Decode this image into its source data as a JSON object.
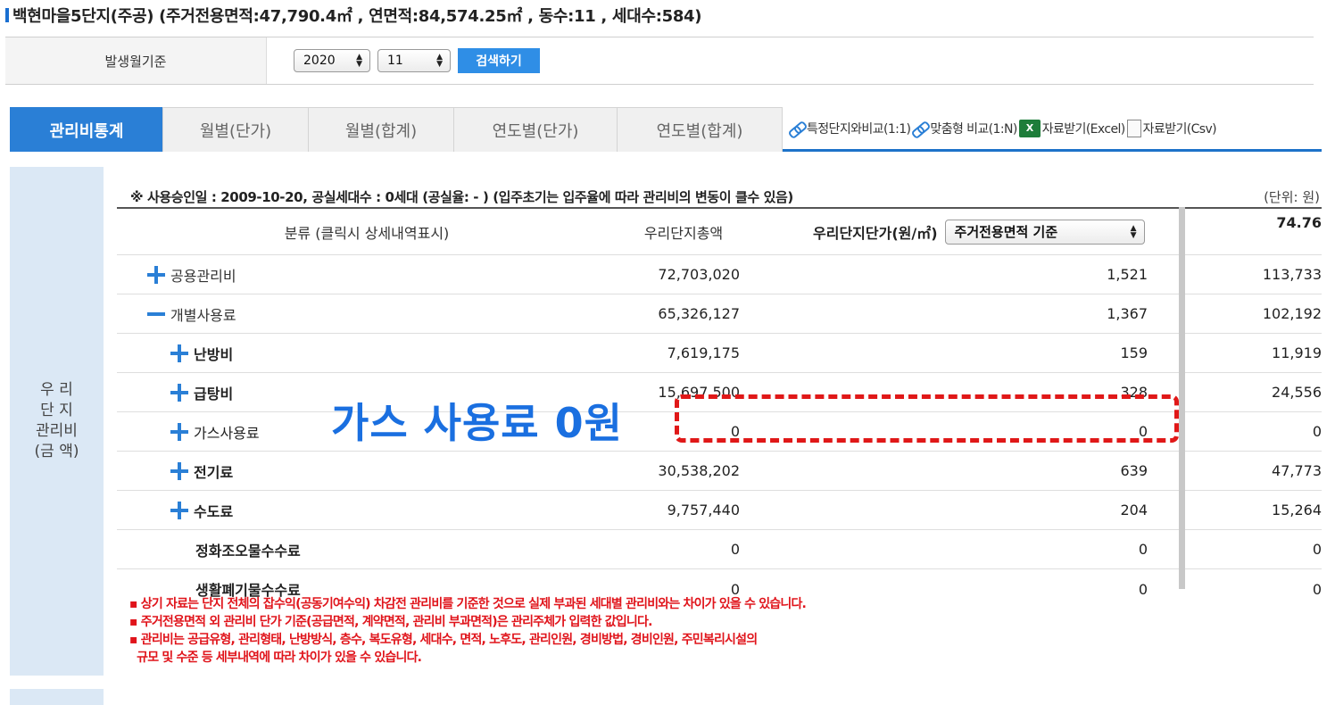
{
  "title": "백현마을5단지(주공) (주거전용면적:47,790.4㎡ , 연면적:84,574.25㎡ , 동수:11 , 세대수:584)",
  "filter": {
    "label": "발생월기준",
    "year": "2020",
    "month": "11",
    "search_label": "검색하기"
  },
  "tabs": [
    "관리비통계",
    "월별(단가)",
    "월별(합계)",
    "연도별(단가)",
    "연도별(합계)"
  ],
  "actions": {
    "compare_specific": "특정단지와비교(1:1)",
    "compare_custom": "맞춤형 비교(1:N)",
    "excel_icon_text": "X",
    "download_excel": "자료받기(Excel)",
    "download_csv": "자료받기(Csv)"
  },
  "side_label": {
    "line1": "우 리",
    "line2": "단 지",
    "line3": "관리비",
    "line4": "(금 액)"
  },
  "note": "※ 사용승인일 : 2009-10-20, 공실세대수 : 0세대 (공실율: - ) (입주초기는 입주율에 따라 관리비의 변동이 클수 있음)",
  "unit": "(단위: 원)",
  "table": {
    "head": {
      "category": "분류 (클릭시 상세내역표시)",
      "total": "우리단지총액",
      "unit_price": "우리단지단가(원/㎡)",
      "basis": "주거전용면적 기준",
      "third": "74.76"
    },
    "rows": [
      {
        "label": "공용관리비",
        "total": "72,703,020",
        "unit": "1,521",
        "third": "113,733"
      },
      {
        "label": "개별사용료",
        "total": "65,326,127",
        "unit": "1,367",
        "third": "102,192"
      },
      {
        "label": "난방비",
        "total": "7,619,175",
        "unit": "159",
        "third": "11,919"
      },
      {
        "label": "급탕비",
        "total": "15,697,500",
        "unit": "328",
        "third": "24,556"
      },
      {
        "label": "가스사용료",
        "total": "0",
        "unit": "0",
        "third": "0"
      },
      {
        "label": "전기료",
        "total": "30,538,202",
        "unit": "639",
        "third": "47,773"
      },
      {
        "label": "수도료",
        "total": "9,757,440",
        "unit": "204",
        "third": "15,264"
      },
      {
        "label": "정화조오물수수료",
        "total": "0",
        "unit": "0",
        "third": "0"
      },
      {
        "label": "생활폐기물수수료",
        "total": "0",
        "unit": "0",
        "third": "0"
      }
    ]
  },
  "overlay_text": "가스 사용료 0원",
  "notes": [
    "▪ 상기 자료는 단지 전체의 잡수익(공동기여수익) 차감전 관리비를 기준한 것으로 실제 부과된 세대별 관리비와는 차이가 있을 수 있습니다.",
    "▪ 주거전용면적 외 관리비 단가 기준(공급면적, 계약면적, 관리비 부과면적)은 관리주체가 입력한 값입니다.",
    "▪ 관리비는 공급유형, 관리형태, 난방방식, 층수, 복도유형, 세대수, 면적, 노후도, 관리인원, 경비방법, 경비인원, 주민복리시설의",
    "  규모 및 수준 등 세부내역에 따라 차이가 있을 수 있습니다."
  ],
  "colors": {
    "accent": "#2a7fd6",
    "overlay": "#1a6fe0",
    "warning": "#e0141b",
    "side_bg": "#dbe8f5"
  }
}
